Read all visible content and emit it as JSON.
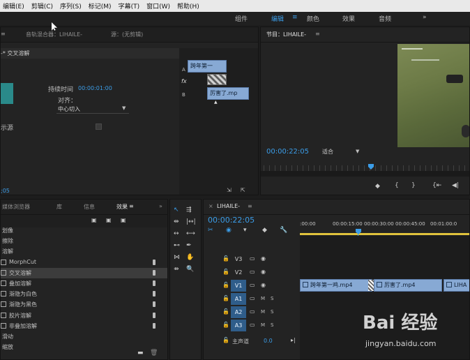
{
  "menu": [
    "编辑(E)",
    "剪辑(C)",
    "序列(S)",
    "标记(M)",
    "字幕(T)",
    "窗口(W)",
    "帮助(H)"
  ],
  "workspaces": [
    {
      "label": "组件",
      "active": false
    },
    {
      "label": "编辑",
      "active": true
    },
    {
      "label": "颜色",
      "active": false
    },
    {
      "label": "效果",
      "active": false
    },
    {
      "label": "音频",
      "active": false
    }
  ],
  "workspace_more": "»",
  "effect_controls": {
    "tabs": [
      "音轨混合器：LIHAILE-",
      "源：(无剪辑)"
    ],
    "header": "-* 交叉溶解",
    "duration_label": "持续时间",
    "duration_value": "00:00:01:00",
    "align_label": "对齐：",
    "align_value": "中心切入",
    "source_label": "示源",
    "clip_a": "跨年第一",
    "clip_b": "厉害了.mp",
    "track_a": "A",
    "track_b": "B",
    "fx": "fx",
    "footer_time": ";05"
  },
  "program": {
    "title": "节目：LIHAILE-",
    "timecode": "00:00:22:05",
    "fit_label": "适合"
  },
  "effects_panel": {
    "tabs": [
      {
        "label": "媒体浏览器",
        "active": false
      },
      {
        "label": "库",
        "active": false
      },
      {
        "label": "信息",
        "active": false
      },
      {
        "label": "效果",
        "active": true
      }
    ],
    "items": [
      {
        "label": "划像",
        "indent": 0,
        "selected": false,
        "icon": false
      },
      {
        "label": "擦除",
        "indent": 0,
        "selected": false,
        "icon": false
      },
      {
        "label": "溶解",
        "indent": 0,
        "selected": false,
        "icon": false
      },
      {
        "label": "MorphCut",
        "indent": 1,
        "selected": false,
        "icon": true
      },
      {
        "label": "交叉溶解",
        "indent": 1,
        "selected": true,
        "icon": true
      },
      {
        "label": "叠加溶解",
        "indent": 1,
        "selected": false,
        "icon": true
      },
      {
        "label": "渐隐为白色",
        "indent": 1,
        "selected": false,
        "icon": true
      },
      {
        "label": "渐隐为黑色",
        "indent": 1,
        "selected": false,
        "icon": true
      },
      {
        "label": "胶片溶解",
        "indent": 1,
        "selected": false,
        "icon": true
      },
      {
        "label": "非叠加溶解",
        "indent": 1,
        "selected": false,
        "icon": true
      },
      {
        "label": "滑动",
        "indent": 0,
        "selected": false,
        "icon": false
      },
      {
        "label": "缩放",
        "indent": 0,
        "selected": false,
        "icon": false
      }
    ]
  },
  "timeline": {
    "title": "LIHAILE-",
    "timecode": "00:00:22:05",
    "ruler": [
      ":00:00",
      "00:00:15:00",
      "00:00:30:00",
      "00:00:45:00",
      "00:01:00:0"
    ],
    "tracks": [
      {
        "name": "V3",
        "type": "video",
        "on": false
      },
      {
        "name": "V2",
        "type": "video",
        "on": false
      },
      {
        "name": "V1",
        "type": "video",
        "on": true
      },
      {
        "name": "A1",
        "type": "audio",
        "on": true
      },
      {
        "name": "A2",
        "type": "audio",
        "on": true
      },
      {
        "name": "A3",
        "type": "audio",
        "on": true
      }
    ],
    "master_label": "主声道",
    "master_value": "0.0",
    "clips": [
      "跨年第一鸡.mp4",
      "厉害了.mp4",
      "LIHA"
    ],
    "mute": "M",
    "solo": "S"
  },
  "watermark": {
    "text": "Bai 经验",
    "url": "jingyan.baidu.com"
  },
  "colors": {
    "accent": "#3b9de8",
    "clip": "#87a9d4",
    "panel": "#232323"
  }
}
